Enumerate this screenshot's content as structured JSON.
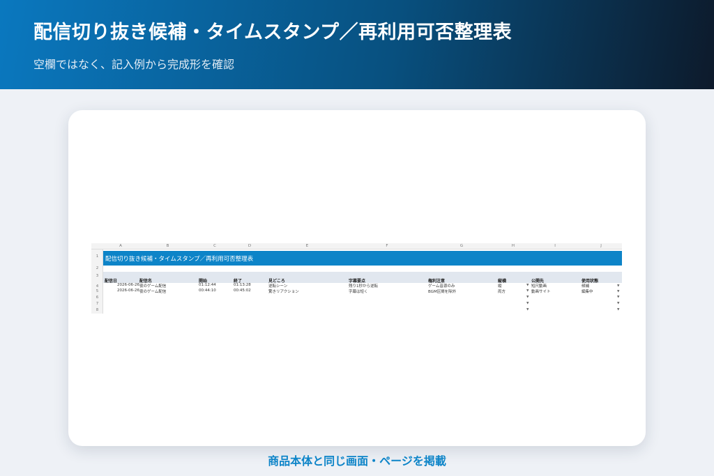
{
  "header": {
    "title": "配信切り抜き候補・タイムスタンプ／再利用可否整理表",
    "subtitle": "空欄ではなく、記入例から完成形を確認"
  },
  "sheet": {
    "column_letters": [
      "A",
      "B",
      "C",
      "D",
      "E",
      "F",
      "G",
      "H",
      "I",
      "J"
    ],
    "row_numbers": [
      "1",
      "2",
      "3",
      "4",
      "5",
      "6",
      "7",
      "8"
    ],
    "title": "配信切り抜き候補・タイムスタンプ／再利用可否整理表",
    "headers": [
      "配信日",
      "配信名",
      "開始",
      "終了",
      "見どころ",
      "字幕要点",
      "権利注意",
      "縦横",
      "公開先",
      "使用状態"
    ],
    "rows": [
      [
        "2026-06-26",
        "夜のゲーム配信",
        "01:12:44",
        "01:13:28",
        "逆転シーン",
        "残り1秒から逆転",
        "ゲーム音源のみ",
        "縦",
        "短尺動画",
        "候補"
      ],
      [
        "2026-06-26",
        "夜のゲーム配信",
        "00:44:10",
        "00:45:02",
        "驚きリアクション",
        "字幕は短く",
        "BGM区間を除外",
        "両方",
        "動画サイト",
        "編集中"
      ]
    ],
    "dropdown_icon": "caret-down-icon"
  },
  "footer": {
    "caption": "商品本体と同じ画面・ページを掲載"
  }
}
